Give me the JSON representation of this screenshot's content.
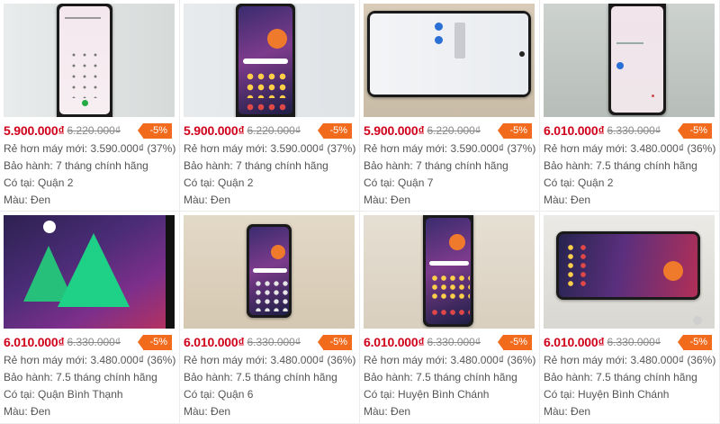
{
  "labels": {
    "cheaper": "Rẻ hơn máy mới:",
    "warranty": "Bảo hành:",
    "location": "Có tại:",
    "color": "Màu:"
  },
  "products": [
    {
      "price": "5.900.000₫",
      "old_price": "6.220.000₫",
      "discount": "-5%",
      "cheaper": "3.590.000₫ (37%)",
      "warranty": "7 tháng chính hãng",
      "location": "Quận 2",
      "color": "Đen",
      "photo": "phone-dialer-screen"
    },
    {
      "price": "5.900.000₫",
      "old_price": "6.220.000₫",
      "discount": "-5%",
      "cheaper": "3.590.000₫ (37%)",
      "warranty": "7 tháng chính hãng",
      "location": "Quận 2",
      "color": "Đen",
      "photo": "phone-home-screen"
    },
    {
      "price": "5.900.000₫",
      "old_price": "6.220.000₫",
      "discount": "-5%",
      "cheaper": "3.590.000₫ (37%)",
      "warranty": "7 tháng chính hãng",
      "location": "Quận 7",
      "color": "Đen",
      "photo": "phone-landscape-welcome"
    },
    {
      "price": "6.010.000₫",
      "old_price": "6.330.000₫",
      "discount": "-5%",
      "cheaper": "3.480.000₫ (36%)",
      "warranty": "7.5 tháng chính hãng",
      "location": "Quận 2",
      "color": "Đen",
      "photo": "phone-welcome-screen"
    },
    {
      "price": "6.010.000₫",
      "old_price": "6.330.000₫",
      "discount": "-5%",
      "cheaper": "3.480.000₫ (36%)",
      "warranty": "7.5 tháng chính hãng",
      "location": "Quận Bình Thạnh",
      "color": "Đen",
      "photo": "phone-closeup-wallpaper"
    },
    {
      "price": "6.010.000₫",
      "old_price": "6.330.000₫",
      "discount": "-5%",
      "cheaper": "3.480.000₫ (36%)",
      "warranty": "7.5 tháng chính hãng",
      "location": "Quận 6",
      "color": "Đen",
      "photo": "phone-on-table"
    },
    {
      "price": "6.010.000₫",
      "old_price": "6.330.000₫",
      "discount": "-5%",
      "cheaper": "3.480.000₫ (36%)",
      "warranty": "7.5 tháng chính hãng",
      "location": "Huyện Bình Chánh",
      "color": "Đen",
      "photo": "phone-on-table-2"
    },
    {
      "price": "6.010.000₫",
      "old_price": "6.330.000₫",
      "discount": "-5%",
      "cheaper": "3.480.000₫ (36%)",
      "warranty": "7.5 tháng chính hãng",
      "location": "Huyện Bình Chánh",
      "color": "Đen",
      "photo": "phone-landscape-home"
    }
  ],
  "colors": {
    "price": "#d0021b",
    "discount_bg": "#f26b1d",
    "text": "#555555",
    "old_price": "#8a8a8a"
  }
}
